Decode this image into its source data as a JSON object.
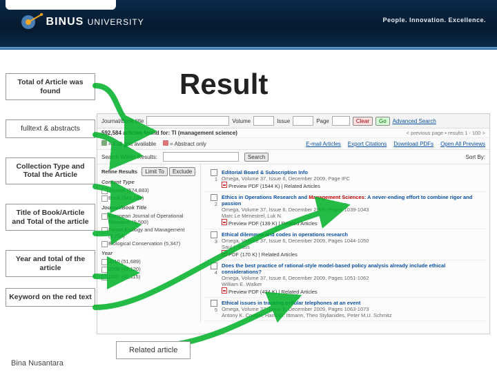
{
  "header": {
    "logo_primary": "BINUS",
    "logo_secondary": "UNIVERSITY",
    "tagline": "People. Innovation. Excellence."
  },
  "slide": {
    "title": "Result",
    "related_label": "Related article",
    "footer": "Bina Nusantara"
  },
  "labels": [
    "Total of Article was found",
    "fulltext & abstracts",
    "Collection Type and Total the Article",
    "Title of Book/Article and Total of the article",
    "Year and total of the article",
    "Keyword on the red text"
  ],
  "searchbar": {
    "journal_label": "Journal/Book title",
    "volume_label": "Volume",
    "issue_label": "Issue",
    "page_label": "Page",
    "clear_label": "Clear",
    "go_label": "Go",
    "advanced_label": "Advanced Search"
  },
  "found_line": "592,584 articles found for: TI (management science)",
  "page_ctl": "< previous page  •  results 1 - 100  >",
  "toggles": {
    "fulltext": "= Full-text available",
    "abstract": "= Abstract only"
  },
  "toolbar": {
    "email": "E-mail Articles",
    "export": "Export Citations",
    "download": "Download PDFs",
    "open_all": "Open All Previews"
  },
  "search_within": "Search Within Results:",
  "search_btn": "Search",
  "sort_by": "Sort By:",
  "facets": {
    "refine_label": "Refine Results",
    "limit_label": "Limit To",
    "exclude_label": "Exclude",
    "content_head": "Content Type",
    "content": [
      "Journal (574,883)",
      "Book (341,109)"
    ],
    "journal_head": "Journal/Book Title",
    "journals": [
      "European Journal of Operational Research (9,500)",
      "Forest Ecology and Management (6,754)",
      "Biological Conservation (5,347)"
    ],
    "year_head": "Year",
    "years": [
      "2010 (51,689)",
      "2009 (49,120)",
      "2007 (42,115)"
    ]
  },
  "results": [
    {
      "n": "1",
      "title": "Editorial Board & Subscription Info",
      "meta": "Omega, Volume 37, Issue 6, December 2009, Page IFC",
      "links": "Preview   PDF (1544 K) | Related Articles"
    },
    {
      "n": "2",
      "title_pre": "Ethics in Operations Research and ",
      "kw": "Management Sciences",
      "title_post": ": A never-ending effort to combine rigor and passion",
      "meta": "Omega, Volume 37, Issue 6, December 2009, Pages 1039-1043",
      "author": "Marc Le Menestrel, Luk N.",
      "links": "Preview   PDF (139 K) | Related Articles"
    },
    {
      "n": "3",
      "title": "Ethical dilemmas and codes in operations research",
      "meta": "Omega, Volume 37, Issue 6, December 2009, Pages 1044-1050",
      "author": "Saul I. Gass",
      "links": "PDF (170 K) | Related Articles"
    },
    {
      "n": "4",
      "title": "Does the best practice of rational-style model-based policy analysis already include ethical considerations?",
      "meta": "Omega, Volume 37, Issue 6, December 2009, Pages 1051-1062",
      "author": "William E. Walker",
      "links": "Preview   PDF (434 K) | Related Articles"
    },
    {
      "n": "5",
      "title": "Ethical issues in tracking cellular telephones at an event",
      "meta": "Omega, Volume 37, Issue 6, December 2009, Pages 1063-1073",
      "author": "Antony K. Cooper, Hans W. Ittmann, Theo Stylianides, Peter M.U. Schmitz"
    }
  ]
}
